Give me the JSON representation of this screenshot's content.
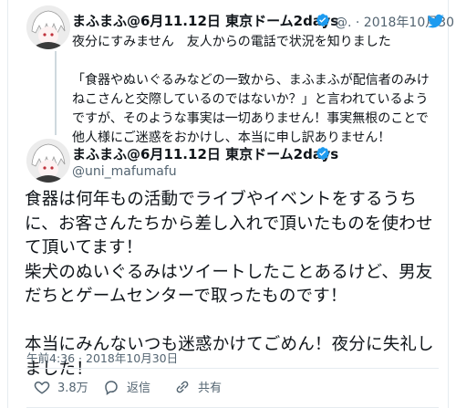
{
  "reply_tweet": {
    "name": "まふまふ@6月11.12日 東京ドーム2days",
    "handle_date": "@. · 2018年10月30日",
    "lines": [
      "夜分にすみません　友人からの電話で状況を知りました",
      "",
      "「食器やぬいぐるみなどの一致から、まふまふが配信者のみけねこさんと交際しているのではないか？」と言われているようですが、そのような事実は一切ありません！事実無根のことで他人様にご迷惑をおかけし、本当に申し訳ありません！"
    ],
    "body_text": "夜分にすみません　友人からの電話で状況を知りました\n\n「食器やぬいぐるみなどの一致から、まふまふが配信者のみけねこさんと交際しているのではないか？」と言われているようですが、そのような事実は一切ありません！事実無根のことで他人様にご迷惑をおかけし、本当に申し訳ありません！"
  },
  "main_tweet": {
    "name": "まふまふ@6月11.12日 東京ドーム2days",
    "handle": "@uni_mafumafu",
    "body_text": "食器は何年もの活動でライブやイベントをするうちに、お客さんたちから差し入れで頂いたものを使わせて頂いてます！\n柴犬のぬいぐるみはツイートしたことあるけど、男友だちとゲームセンターで取ったものです！\n\n本当にみんないつも迷惑かけてごめん！夜分に失礼しました！",
    "timestamp": "午前4:36 · 2018年10月30日",
    "like_count": "3.8万",
    "reply_label": "返信",
    "share_label": "共有"
  },
  "colors": {
    "brand_blue": "#1d9bf0",
    "verified_blue": "#1d9bf0",
    "text_secondary": "#536471"
  },
  "icons": [
    "twitter-bird-icon",
    "verified-badge-icon",
    "heart-icon",
    "reply-icon",
    "share-icon"
  ]
}
